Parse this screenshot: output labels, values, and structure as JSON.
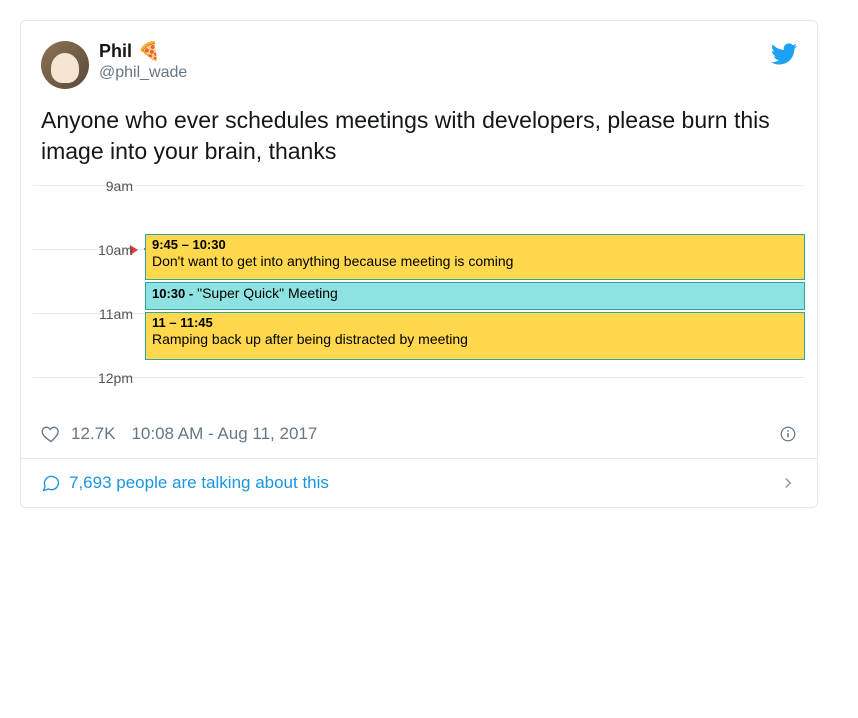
{
  "user": {
    "display_name": "Phil",
    "emoji": "🍕",
    "handle": "@phil_wade"
  },
  "tweet_text": "Anyone who ever schedules meetings with developers, please burn this image into your brain, thanks",
  "calendar": {
    "hours": [
      "9am",
      "10am",
      "11am",
      "12pm"
    ],
    "events": [
      {
        "time": "9:45 – 10:30",
        "title": "Don't want to get into anything because meeting is coming"
      },
      {
        "time": "10:30 -",
        "title": "\"Super Quick\" Meeting"
      },
      {
        "time": "11 – 11:45",
        "title": "Ramping back up after being distracted by meeting"
      }
    ]
  },
  "meta": {
    "likes": "12.7K",
    "timestamp": "10:08 AM - Aug 11, 2017"
  },
  "footer": {
    "talking": "7,693 people are talking about this"
  }
}
